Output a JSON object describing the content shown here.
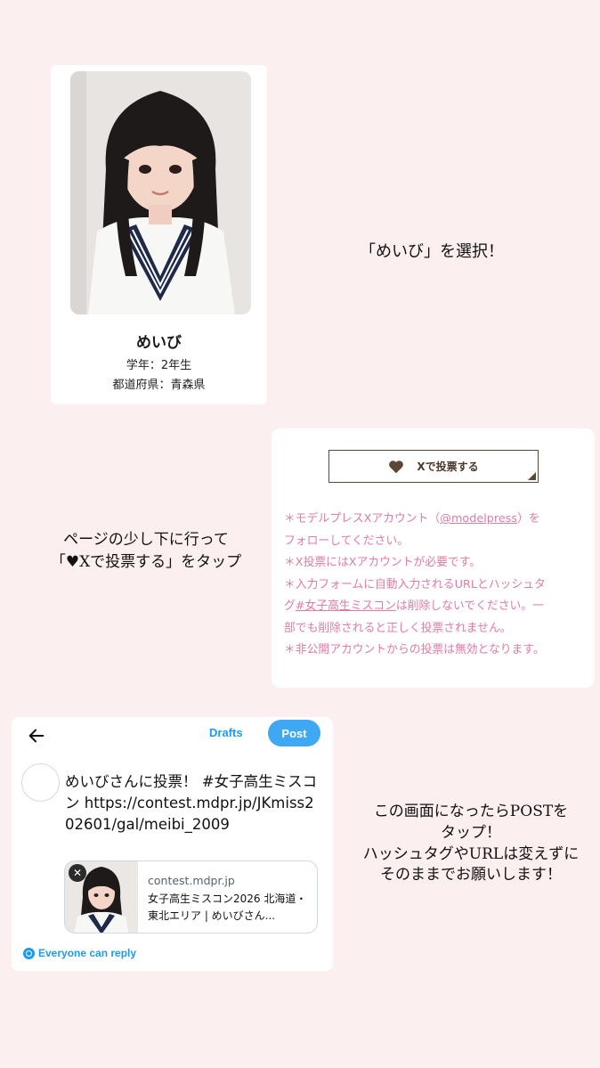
{
  "profile": {
    "name": "めいび",
    "grade": "学年：2年生",
    "prefecture": "都道府県：青森県"
  },
  "instructions": {
    "step1": "「めいび」を選択！",
    "step2_line1": "ページの少し下に行って",
    "step2_line2": "「♥Xで投票する」をタップ",
    "step3_line1": "この画面になったらPOSTを",
    "step3_line2": "タップ！",
    "step3_line3": "ハッシュタグやURLは変えずに",
    "step3_line4": "そのままでお願いします！"
  },
  "vote": {
    "button_label": "Xで投票する",
    "notes": {
      "n1_pre": "＊モデルプレスXアカウント（",
      "n1_link": "@modelpress",
      "n1_post": "）を",
      "n1_cont": "フォローしてください。",
      "n2": "＊X投票にはXアカウントが必要です。",
      "n3_pre": "＊入力フォームに自動入力されるURLとハッシュタ",
      "n3_cont_pre": "グ",
      "n3_link": "#女子高生ミスコン",
      "n3_cont_post": "は削除しないでください。一",
      "n3_cont2": "部でも削除されると正しく投票されません。",
      "n4": "＊非公開アカウントからの投票は無効となります。"
    }
  },
  "compose": {
    "drafts_label": "Drafts",
    "post_label": "Post",
    "tweet_text": "めいびさんに投票！ #女子高生ミスコン https://contest.mdpr.jp/JKmiss202601/gal/meibi_2009",
    "link_card": {
      "domain": "contest.mdpr.jp",
      "title": "女子高生ミスコン2026 北海道・東北エリア | めいびさん..."
    },
    "reply_setting": "Everyone can reply"
  },
  "colors": {
    "background": "#fcefef",
    "notes_pink": "#e07ba6",
    "vote_brown": "#5b4736",
    "x_blue": "#1d9bf0"
  }
}
